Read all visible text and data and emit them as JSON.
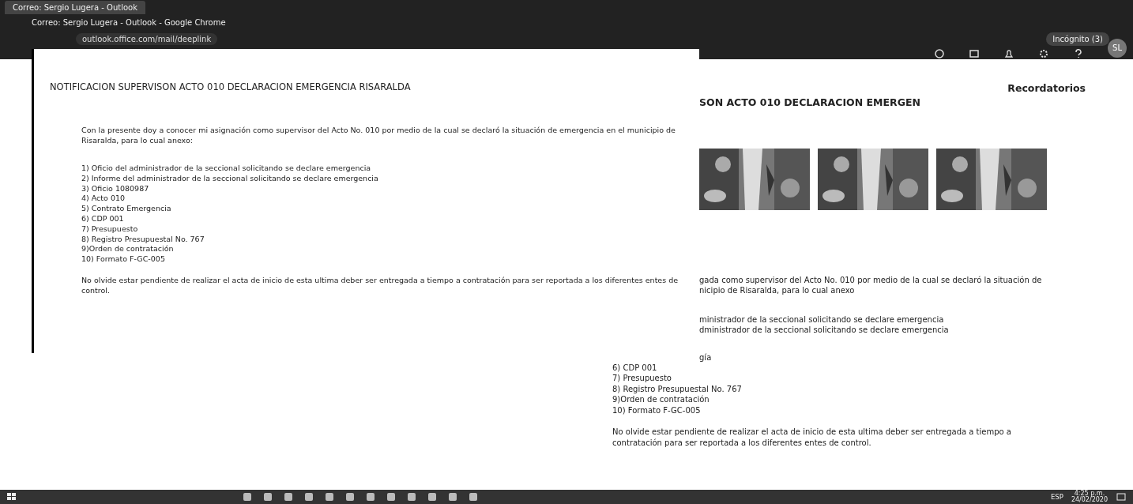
{
  "browser": {
    "tab_title": "Correo: Sergio Lugera - Outlook",
    "window_title": "Correo: Sergio Lugera - Outlook - Google Chrome",
    "url": "outlook.office.com/mail/deeplink",
    "profile": "Incógnito (3)"
  },
  "toolbar": {
    "avatar": "SL"
  },
  "popup": {
    "subject": "NOTIFICACION SUPERVISON ACTO 010 DECLARACION EMERGENCIA RISARALDA",
    "intro": "Con la presente doy a conocer mi asignación como supervisor del Acto No. 010 por medio de la cual se declaró la situación de emergencia en el municipio de Risaralda, para lo cual anexo:",
    "attachments": [
      "1) Oficio del administrador de la seccional solicitando se declare emergencia",
      "2) Informe del administrador de la seccional solicitando se declare emergencia",
      "3) Oficio 1080987",
      "4) Acto 010",
      "5) Contrato Emergencia",
      "6) CDP 001",
      "7) Presupuesto",
      "8) Registro Presupuestal No. 767",
      "9)Orden de contratación",
      "10) Formato F-GC-005"
    ],
    "closing": "No olvide estar pendiente de realizar el acta de inicio de esta ultima deber ser entregada a tiempo a contratación para ser reportada a los diferentes entes de control."
  },
  "reminders": {
    "title": "Recordatorios"
  },
  "reading_pane": {
    "subject": "SON ACTO 010 DECLARACION EMERGEN",
    "pictures": [
      {
        "kind": "picture"
      },
      {
        "kind": "picture"
      },
      {
        "kind": "picture"
      }
    ],
    "fragments": [
      "gada como supervisor del Acto No. 010 por medio de la cual se declaró la situación de",
      "nicipio de Risaralda, para lo cual anexo"
    ],
    "fragments_2": [
      "ministrador de la seccional solicitando se declare emergencia",
      "dministrador de la seccional solicitando se declare emergencia"
    ],
    "fragment_3": "gía",
    "attachments": [
      "6) CDP 001",
      "7) Presupuesto",
      "8) Registro Presupuestal No. 767",
      "9)Orden de contratación",
      "10) Formato F-GC-005"
    ],
    "closing": "No olvide estar pendiente de realizar el acta de inicio de esta ultima deber ser entregada a tiempo a contratación para ser reportada a los diferentes entes de control."
  },
  "taskbar": {
    "language": "ESP",
    "time": "4:25 p.m.",
    "date": "24/02/2020"
  }
}
